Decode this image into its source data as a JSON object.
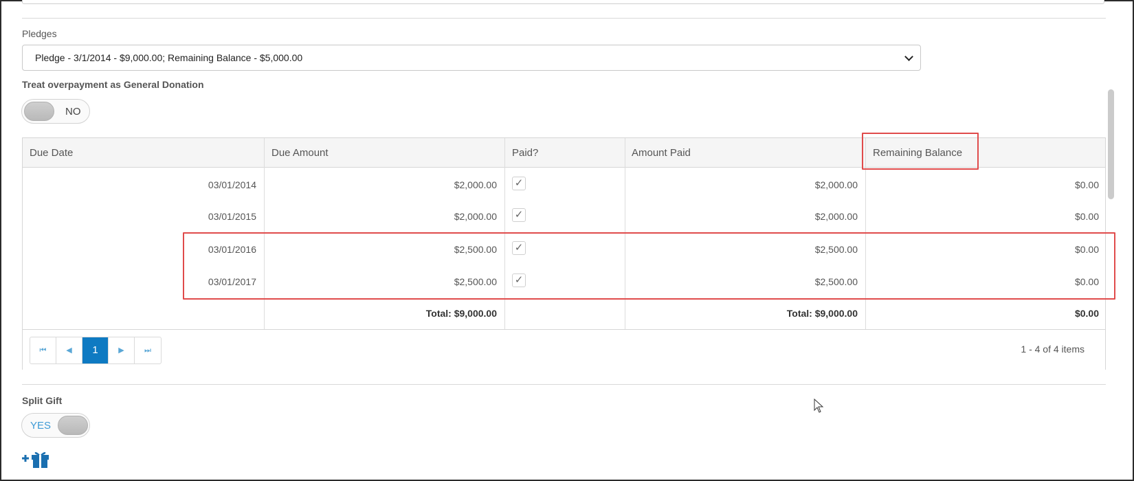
{
  "pledges": {
    "label": "Pledges",
    "selected": "Pledge - 3/1/2014 - $9,000.00; Remaining Balance - $5,000.00"
  },
  "overpayment": {
    "label": "Treat overpayment as General Donation",
    "toggle_text": "NO"
  },
  "grid": {
    "columns": [
      "Due Date",
      "Due Amount",
      "Paid?",
      "Amount Paid",
      "Remaining Balance"
    ],
    "rows": [
      {
        "due_date": "03/01/2014",
        "due_amount": "$2,000.00",
        "paid": true,
        "amount_paid": "$2,000.00",
        "remaining": "$0.00"
      },
      {
        "due_date": "03/01/2015",
        "due_amount": "$2,000.00",
        "paid": true,
        "amount_paid": "$2,000.00",
        "remaining": "$0.00"
      },
      {
        "due_date": "03/01/2016",
        "due_amount": "$2,500.00",
        "paid": true,
        "amount_paid": "$2,500.00",
        "remaining": "$0.00"
      },
      {
        "due_date": "03/01/2017",
        "due_amount": "$2,500.00",
        "paid": true,
        "amount_paid": "$2,500.00",
        "remaining": "$0.00"
      }
    ],
    "totals": {
      "due_amount": "Total: $9,000.00",
      "amount_paid": "Total: $9,000.00",
      "remaining": "$0.00"
    },
    "checkmark": "✓"
  },
  "pager": {
    "first": "⏮",
    "prev": "◀",
    "current_page": "1",
    "next": "▶",
    "last": "⏭",
    "info": "1 - 4 of 4 items"
  },
  "split_gift": {
    "label": "Split Gift",
    "toggle_text": "YES"
  },
  "icons": {
    "add_gift": "gift-plus-icon",
    "cursor": "mouse-pointer-icon"
  },
  "colors": {
    "accent": "#0e7ac2",
    "highlight": "#e04b4b",
    "yes_text": "#3d9ad6"
  }
}
